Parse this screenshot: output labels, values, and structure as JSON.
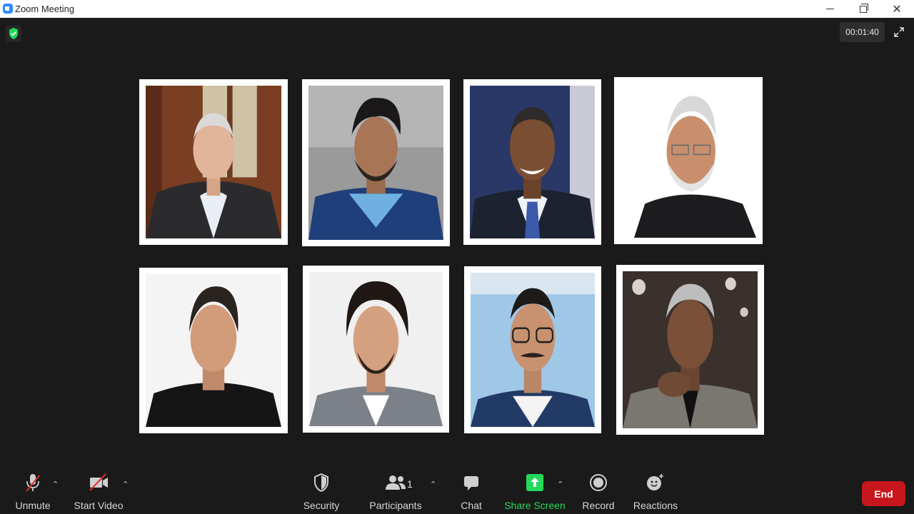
{
  "window": {
    "title": "Zoom Meeting",
    "close_glyph": "✕"
  },
  "meeting": {
    "timer": "00:01:40"
  },
  "toolbar": {
    "unmute": "Unmute",
    "start_video": "Start Video",
    "security": "Security",
    "participants": "Participants",
    "participants_count": "1",
    "chat": "Chat",
    "share_screen": "Share Screen",
    "record": "Record",
    "reactions": "Reactions",
    "caret": "⌃",
    "end": "End"
  },
  "colors": {
    "background": "#1a1a1a",
    "accent_green": "#23d959",
    "end_red": "#c7161d",
    "zoom_blue": "#2d8cff"
  },
  "tiles": [
    {
      "icon": "participant-photo"
    },
    {
      "icon": "participant-photo"
    },
    {
      "icon": "participant-photo"
    },
    {
      "icon": "participant-photo"
    },
    {
      "icon": "participant-photo"
    },
    {
      "icon": "participant-photo"
    },
    {
      "icon": "participant-photo"
    },
    {
      "icon": "participant-photo"
    }
  ]
}
